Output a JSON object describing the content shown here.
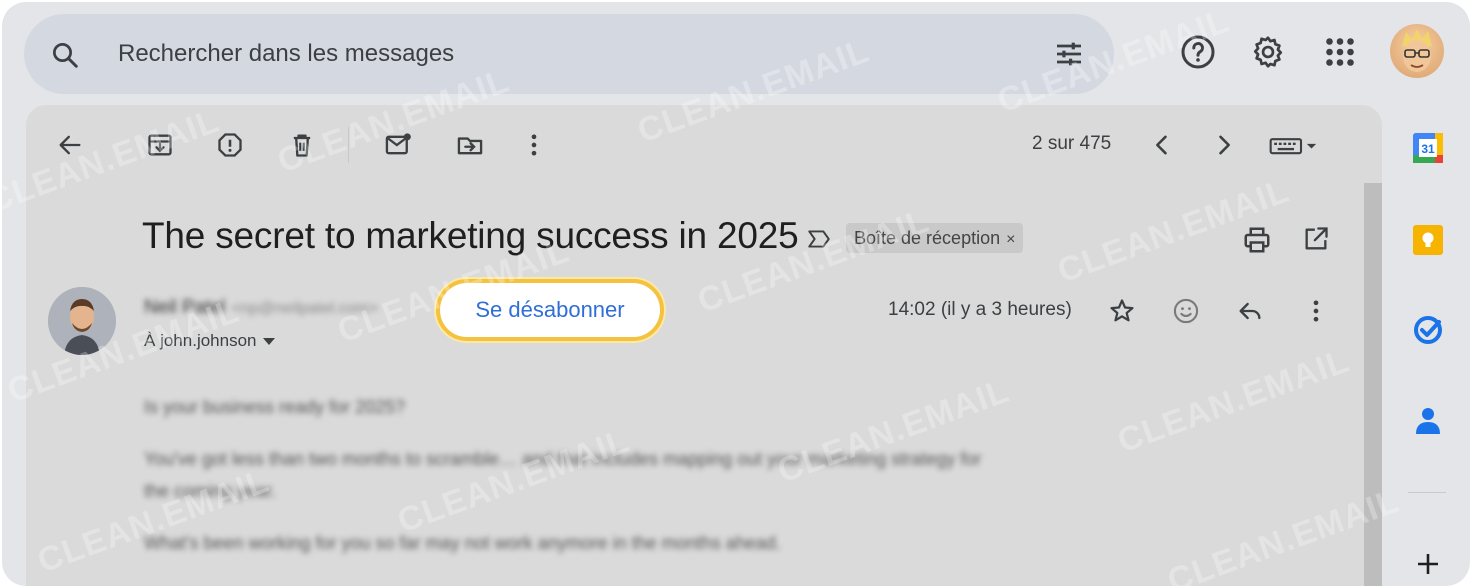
{
  "search": {
    "placeholder": "Rechercher dans les messages",
    "icon": "search-icon",
    "filter_icon": "tune-icon"
  },
  "header_icons": [
    "help-icon",
    "gear-icon",
    "apps-grid-icon",
    "account-avatar"
  ],
  "toolbar": {
    "icons": [
      "back-arrow-icon",
      "archive-icon",
      "report-spam-icon",
      "delete-icon",
      "mark-unread-icon",
      "move-to-icon",
      "more-vert-icon"
    ],
    "pager_text": "2 sur 475",
    "nav_icons": [
      "chevron-left-icon",
      "chevron-right-icon",
      "keyboard-icon"
    ]
  },
  "email": {
    "subject": "The secret to marketing success in 2025",
    "label_chip": "Boîte de réception",
    "label_chip_close": "×",
    "sender_name": "Neil Patel",
    "sender_email": "<np@neilpatel.com>",
    "to_prefix": "À",
    "to_recipient": "john.johnson",
    "unsubscribe_label": "Se désabonner",
    "timestamp": "14:02 (il y a 3 heures)",
    "body_lines": [
      "Is your business ready for 2025?",
      "You've got less than two months to scramble… and that includes mapping out your marketing strategy for",
      "the coming year.",
      "What's been working for you so far may not work anymore in the months ahead."
    ]
  },
  "side_panel": {
    "calendar_day": "31",
    "add_label": "+"
  },
  "watermark": "CLEAN.EMAIL",
  "colors": {
    "accent_blue": "#2f6fd6",
    "highlight_yellow": "#f4c23f",
    "search_bg": "#d4d9e1"
  }
}
